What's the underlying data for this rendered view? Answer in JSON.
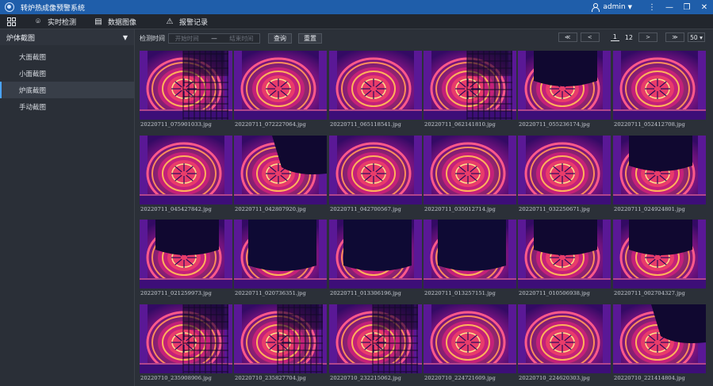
{
  "window": {
    "title": "转炉热成像预警系统",
    "user": "admin",
    "controls": [
      "⋮",
      "—",
      "❐",
      "✕"
    ]
  },
  "nav": [
    {
      "icon": "grid-icon",
      "label": ""
    },
    {
      "icon": "location-pin-icon",
      "label": "实时检测"
    },
    {
      "icon": "document-icon",
      "label": "数据图像"
    },
    {
      "icon": "warning-icon",
      "label": "报警记录"
    }
  ],
  "sidebar": {
    "header": "炉体截图",
    "items": [
      {
        "label": "大面截图",
        "active": false
      },
      {
        "label": "小面截图",
        "active": false
      },
      {
        "label": "炉底截图",
        "active": true
      },
      {
        "label": "手动截图",
        "active": false
      }
    ]
  },
  "filter": {
    "label": "检测时间",
    "start_placeholder": "开始时间",
    "separator": "—",
    "end_placeholder": "结束时间",
    "query": "查询",
    "reset": "重置"
  },
  "pager": {
    "first": "≪",
    "prev": "<",
    "current": "1",
    "total": "12",
    "next": ">",
    "last": "≫",
    "page_size": "50 ▾"
  },
  "images": [
    {
      "name": "20220711_075901033.jpg",
      "variant": "grid"
    },
    {
      "name": "20220711_072227064.jpg",
      "variant": "normal"
    },
    {
      "name": "20220711_065118541.jpg",
      "variant": "normal"
    },
    {
      "name": "20220711_062141810.jpg",
      "variant": "grid"
    },
    {
      "name": "20220711_055236174.jpg",
      "variant": "dark_top"
    },
    {
      "name": "20220711_052412708.jpg",
      "variant": "normal"
    },
    {
      "name": "20220711_045427842.jpg",
      "variant": "normal"
    },
    {
      "name": "20220711_042807920.jpg",
      "variant": "dark_corner"
    },
    {
      "name": "20220711_042700567.jpg",
      "variant": "normal"
    },
    {
      "name": "20220711_035012714.jpg",
      "variant": "normal"
    },
    {
      "name": "20220711_032250671.jpg",
      "variant": "normal"
    },
    {
      "name": "20220711_024924801.jpg",
      "variant": "dark_top"
    },
    {
      "name": "20220711_021259973.jpg",
      "variant": "dark_top"
    },
    {
      "name": "20220711_020736351.jpg",
      "variant": "dark_big"
    },
    {
      "name": "20220711_013306196.jpg",
      "variant": "dark_big"
    },
    {
      "name": "20220711_013257151.jpg",
      "variant": "dark_big"
    },
    {
      "name": "20220711_010506938.jpg",
      "variant": "dark_top"
    },
    {
      "name": "20220711_002704327.jpg",
      "variant": "dark_top"
    },
    {
      "name": "20220710_235908906.jpg",
      "variant": "grid"
    },
    {
      "name": "20220710_235827704.jpg",
      "variant": "grid"
    },
    {
      "name": "20220710_232215062.jpg",
      "variant": "grid"
    },
    {
      "name": "20220710_224721609.jpg",
      "variant": "normal"
    },
    {
      "name": "20220710_224620303.jpg",
      "variant": "normal"
    },
    {
      "name": "20220710_221414804.jpg",
      "variant": "dark_corner"
    }
  ]
}
